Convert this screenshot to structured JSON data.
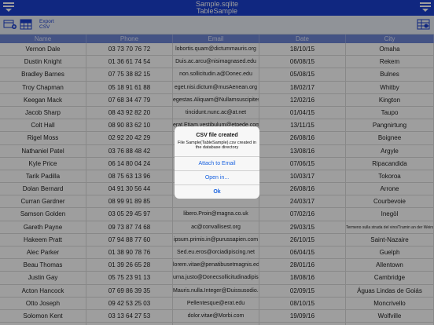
{
  "navbar": {
    "title": "Sample.sqlite",
    "subtitle": "TableSample"
  },
  "toolbar": {
    "export_label_1": "Export",
    "export_label_2": "CSV"
  },
  "table": {
    "headers": [
      "Name",
      "Phone",
      "Email",
      "Date",
      "City"
    ],
    "rows": [
      [
        "Vernon Dale",
        "03 73 70 76 72",
        "lobortis.quam@dictummauris.org",
        "18/10/15",
        "Omaha"
      ],
      [
        "Dustin Knight",
        "01 36 61 74 54",
        "Duis.ac.arcu@nisimagnased.edu",
        "06/08/15",
        "Rekem"
      ],
      [
        "Bradley Barnes",
        "07 75 38 82 15",
        "non.sollicitudin.a@Donec.edu",
        "05/08/15",
        "Bulnes"
      ],
      [
        "Troy Chapman",
        "05 18 91 61 88",
        "eget.nisi.dictum@musAenean.org",
        "18/02/17",
        "Whitby"
      ],
      [
        "Keegan Mack",
        "07 68 34 47 79",
        "egestas.Aliquam@Nullamsuscipitest.com",
        "12/02/16",
        "Kington"
      ],
      [
        "Jacob Sharp",
        "08 43 92 82 20",
        "tincidunt.nunc.ac@at.net",
        "01/04/15",
        "Taupo"
      ],
      [
        "Colt Hall",
        "08 90 83 62 10",
        "erat.Etiam.vestibulum@etpede.com",
        "13/11/15",
        "Pangnirtung"
      ],
      [
        "Rigel Moss",
        "02 92 20 42 29",
        "",
        "26/08/16",
        "Boignee"
      ],
      [
        "Nathaniel Patel",
        "03 76 88 48 42",
        "",
        "13/08/16",
        "Argyle"
      ],
      [
        "Kyle Price",
        "06 14 80 04 24",
        "",
        "07/06/15",
        "Ripacandida"
      ],
      [
        "Tarik Padilla",
        "08 75 63 13 96",
        "",
        "10/03/17",
        "Tokoroa"
      ],
      [
        "Dolan Bernard",
        "04 91 30 56 44",
        "",
        "26/08/16",
        "Arrone"
      ],
      [
        "Curran Gardner",
        "08 99 91 89 85",
        "",
        "24/03/17",
        "Courbevoie"
      ],
      [
        "Samson Golden",
        "03 05 29 45 97",
        "libero.Proin@magna.co.uk",
        "07/02/16",
        "Inegöl"
      ],
      [
        "Gareth Payne",
        "09 73 87 74 68",
        "ac@convallisest.org",
        "29/03/15",
        "Termeno sulla strada del vino/Tramin an der Weinstrasse"
      ],
      [
        "Hakeem Pratt",
        "07 94 88 77 60",
        "ipsum.primis.in@purussapien.com",
        "26/10/15",
        "Saint-Nazaire"
      ],
      [
        "Alec Parker",
        "01 38 90 78 76",
        "Sed.eu.eros@orciadipiscing.net",
        "06/04/15",
        "Guelph"
      ],
      [
        "Beau Thomas",
        "01 39 26 65 28",
        "lorem.vitae@penatibusetmagnis.edu",
        "28/01/16",
        "Allentown"
      ],
      [
        "Justin Gay",
        "05 75 23 91 13",
        "urna.justo@Donecsollicitudinadipiscing.ca",
        "18/08/16",
        "Cambridge"
      ],
      [
        "Acton Hancock",
        "07 69 86 39 35",
        "Mauris.nulla.Integer@Duissusodio.co.uk",
        "02/09/15",
        "Águas Lindas de Goiás"
      ],
      [
        "Otto Joseph",
        "09 42 53 25 03",
        "Pellentesque@erat.edu",
        "08/10/15",
        "Moncrivello"
      ],
      [
        "Solomon Kent",
        "03 13 64 27 53",
        "dolor.vitae@Morbi.com",
        "19/09/16",
        "Wolfville"
      ],
      [
        "Keegan Taylor",
        "03 34 94 62 41",
        "augue.id@uteratSed.ca",
        "26/04/16",
        "Wijnegem"
      ]
    ]
  },
  "dialog": {
    "title": "CSV file created",
    "message": "File Sample(TableSample).csv created in the database directory",
    "buttons": [
      "Attach to Email",
      "Open in...",
      "Ok"
    ]
  },
  "colors": {
    "navbar": "#1b3fcf",
    "header": "#6f86d6",
    "link": "#1a63e0"
  }
}
